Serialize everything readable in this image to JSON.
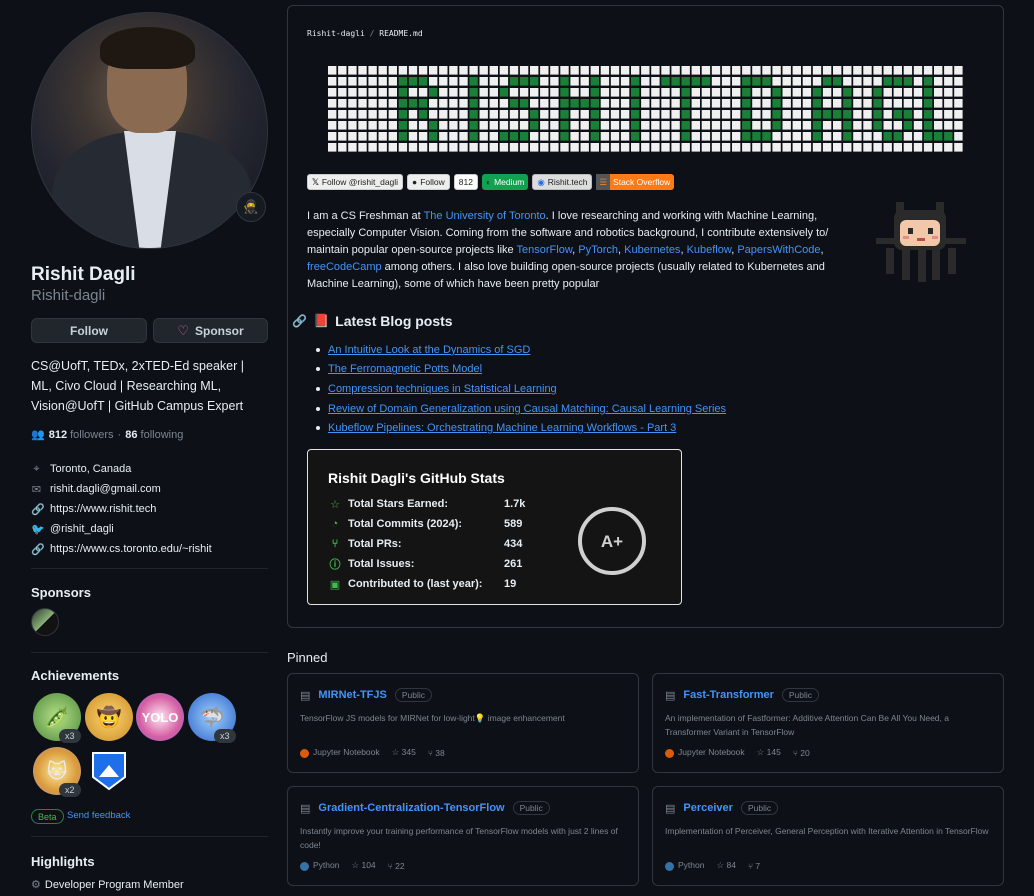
{
  "profile": {
    "name": "Rishit Dagli",
    "login": "Rishit-dagli",
    "follow_label": "Follow",
    "sponsor_label": "Sponsor",
    "bio": "CS@UofT, TEDx, 2xTED-Ed speaker | ML, Civo Cloud | Researching ML, Vision@UofT | GitHub Campus Expert",
    "followers": "812",
    "followers_label": "followers",
    "separator": "·",
    "following": "86",
    "following_label": "following",
    "details": [
      {
        "icon": "location-icon",
        "text": "Toronto, Canada"
      },
      {
        "icon": "mail-icon",
        "text": "rishit.dagli@gmail.com"
      },
      {
        "icon": "link-icon",
        "text": "https://www.rishit.tech"
      },
      {
        "icon": "twitter-icon",
        "text": "@rishit_dagli"
      },
      {
        "icon": "link-icon",
        "text": "https://www.cs.toronto.edu/~rishit"
      }
    ]
  },
  "sponsors": {
    "title": "Sponsors"
  },
  "achievements": {
    "title": "Achievements",
    "badges": [
      {
        "icon": "pair-extraordinaire-icon",
        "count": "x3"
      },
      {
        "icon": "starstruck-icon",
        "count": ""
      },
      {
        "icon": "yolo-icon",
        "count": ""
      },
      {
        "icon": "pull-shark-icon",
        "count": "x3"
      },
      {
        "icon": "quickdraw-icon",
        "count": "x2"
      },
      {
        "icon": "arctic-code-vault-icon",
        "count": ""
      }
    ],
    "beta": "Beta",
    "feedback": "Send feedback"
  },
  "highlights": {
    "title": "Highlights",
    "item": "Developer Program Member"
  },
  "readme": {
    "owner": "Rishit-dagli",
    "sep": "/",
    "file": "README.md",
    "badges": [
      {
        "icon": "x-logo-icon",
        "label": "Follow @rishit_dagli"
      },
      {
        "icon": "github-logo-icon",
        "label": "Follow"
      },
      {
        "icon": "",
        "label": "812"
      },
      {
        "icon": "medium-logo-icon",
        "label": "Medium"
      },
      {
        "icon": "globe-icon",
        "label": "Rishit.tech"
      },
      {
        "icon": "stackoverflow-logo-icon",
        "label": "Stack Overflow"
      }
    ],
    "intro": {
      "p1": "I am a CS Freshman at ",
      "uoft": "The University of Toronto",
      "p2": ". I love researching and working with Machine Learning, especially Computer Vision. Coming from the software and robotics background, I contribute extensively to/ maintain popular open-source projects like ",
      "l1": "TensorFlow",
      "l2": "PyTorch",
      "l3": "Kubernetes",
      "l4": "Kubeflow",
      "l5": "PapersWithCode",
      "l6": "freeCodeCamp",
      "comma": ", ",
      "p3": " among others. I also love building open-source projects (usually related to Kubernetes and Machine Learning), some of which have been pretty popular"
    },
    "blog_title": "Latest Blog posts",
    "blog_posts": [
      "An Intuitive Look at the Dynamics of SGD",
      "The Ferromagnetic Potts Model",
      "Compression techniques in Statistical Learning",
      "Review of Domain Generalization using Causal Matching: Causal Learning Series",
      "Kubeflow Pipelines: Orchestrating Machine Learning Workflows - Part 3"
    ]
  },
  "stats": {
    "title": "Rishit Dagli's GitHub Stats",
    "rows": [
      {
        "icon": "star-icon",
        "label": "Total Stars Earned:",
        "value": "1.7k"
      },
      {
        "icon": "history-icon",
        "label": "Total Commits (2024):",
        "value": "589"
      },
      {
        "icon": "pull-request-icon",
        "label": "Total PRs:",
        "value": "434"
      },
      {
        "icon": "issue-icon",
        "label": "Total Issues:",
        "value": "261"
      },
      {
        "icon": "repo-icon",
        "label": "Contributed to (last year):",
        "value": "19"
      }
    ],
    "grade": "A+"
  },
  "pinned": {
    "title": "Pinned",
    "repos": [
      {
        "name": "MIRNet-TFJS",
        "visibility": "Public",
        "description": "TensorFlow JS models for MIRNet for low-light💡 image enhancement",
        "language": "Jupyter Notebook",
        "language_color": "#DA5B0B",
        "stars": "345",
        "forks": "38"
      },
      {
        "name": "Fast-Transformer",
        "visibility": "Public",
        "description": "An implementation of Fastformer: Additive Attention Can Be All You Need, a Transformer Variant in TensorFlow",
        "language": "Jupyter Notebook",
        "language_color": "#DA5B0B",
        "stars": "145",
        "forks": "20"
      },
      {
        "name": "Gradient-Centralization-TensorFlow",
        "visibility": "Public",
        "description": "Instantly improve your training performance of TensorFlow models with just 2 lines of code!",
        "language": "Python",
        "language_color": "#3572A5",
        "stars": "104",
        "forks": "22"
      },
      {
        "name": "Perceiver",
        "visibility": "Public",
        "description": "Implementation of Perceiver, General Perception with Iterative Attention in TensorFlow",
        "language": "Python",
        "language_color": "#3572A5",
        "stars": "84",
        "forks": "7"
      }
    ]
  },
  "colors": {
    "accent": "#4493f8",
    "success": "#3fb950",
    "banner_green": "#1a7f37",
    "banner_white": "#f0f0f0"
  }
}
